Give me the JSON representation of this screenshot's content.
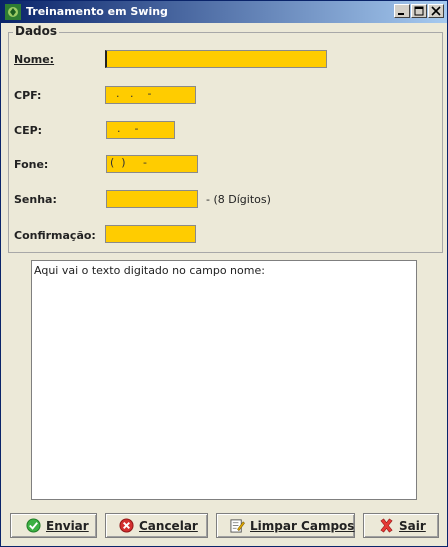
{
  "window": {
    "title": "Treinamento em Swing"
  },
  "dados": {
    "title": "Dados",
    "labels": {
      "nome": "Nome:",
      "cpf": "CPF:",
      "cep": "CEP:",
      "fone": "Fone:",
      "senha": "Senha:",
      "confirmacao": "Confirmação:"
    },
    "values": {
      "nome": "",
      "cpf": "  .   .    -",
      "cep": "  .    -",
      "fone": "(  )     -",
      "senha": "",
      "confirmacao": ""
    },
    "senha_hint": "- (8 Dígitos)"
  },
  "output": {
    "text": "Aqui vai o texto digitado no campo nome:"
  },
  "buttons": {
    "enviar": "Enviar",
    "cancelar": "Cancelar",
    "limpar": "Limpar Campos",
    "sair": "Sair"
  },
  "colors": {
    "field_bg": "#ffcc00",
    "titlebar": "#0a246a"
  }
}
